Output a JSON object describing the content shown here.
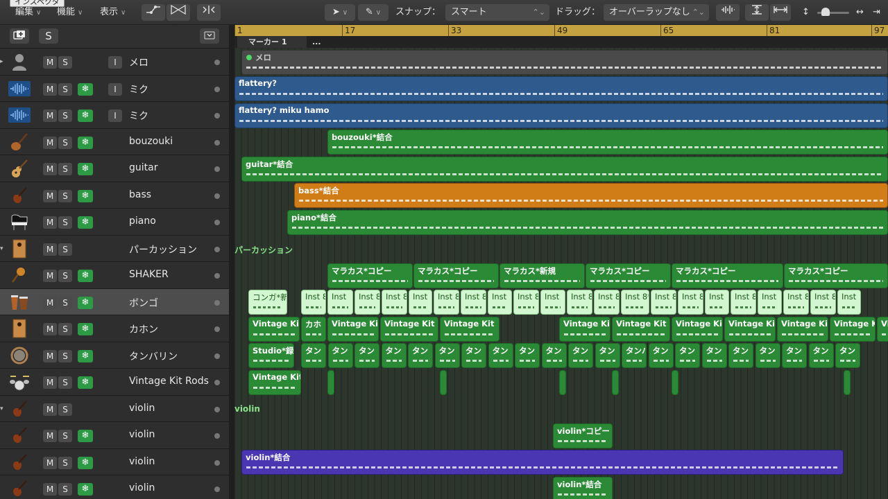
{
  "inspector_tip": "インスペクタ",
  "toolbar": {
    "menus": [
      {
        "label": "編集"
      },
      {
        "label": "機能"
      },
      {
        "label": "表示"
      }
    ],
    "snap_label": "スナップ：",
    "snap_value": "スマート",
    "drag_label": "ドラッグ：",
    "drag_value": "オーバーラップなし"
  },
  "track_header": {
    "add_icon": "add-track-icon",
    "s_button": "S",
    "collapse_icon": "collapse-icon"
  },
  "tracks": [
    {
      "name": "メロ",
      "icon": "person-icon",
      "i": "I",
      "freeze": false,
      "disclosure": "▸"
    },
    {
      "name": "ミク",
      "icon": "waveform-icon",
      "i": "I",
      "freeze": true
    },
    {
      "name": "ミク",
      "icon": "waveform-icon",
      "i": "I",
      "freeze": true
    },
    {
      "name": "bouzouki",
      "icon": "bouzouki-icon",
      "freeze": true
    },
    {
      "name": "guitar",
      "icon": "guitar-icon",
      "freeze": true
    },
    {
      "name": "bass",
      "icon": "violin-icon",
      "freeze": true
    },
    {
      "name": "piano",
      "icon": "piano-icon",
      "freeze": true
    },
    {
      "name": "パーカッション",
      "icon": "cajon-icon",
      "freeze": false,
      "disclosure": "▾"
    },
    {
      "name": "SHAKER",
      "icon": "maracas-icon",
      "freeze": true
    },
    {
      "name": "ボンゴ",
      "icon": "bongo-icon",
      "freeze": true,
      "selected": true
    },
    {
      "name": "カホン",
      "icon": "cajon-icon",
      "freeze": true
    },
    {
      "name": "タンバリン",
      "icon": "tambourine-icon",
      "freeze": true
    },
    {
      "name": "Vintage Kit Rods",
      "icon": "drumkit-icon",
      "freeze": true
    },
    {
      "name": "violin",
      "icon": "violin-icon",
      "freeze": false,
      "disclosure": "▾"
    },
    {
      "name": "violin",
      "icon": "violin-icon",
      "freeze": true
    },
    {
      "name": "violin",
      "icon": "violin-icon",
      "freeze": true
    },
    {
      "name": "violin",
      "icon": "violin-icon",
      "freeze": true
    }
  ],
  "button_labels": {
    "m": "M",
    "s": "S",
    "i": "I",
    "freeze": "❄"
  },
  "ruler": [
    "1",
    "17",
    "33",
    "49",
    "65",
    "81",
    "97"
  ],
  "markers": [
    {
      "label": "マーカー 1"
    },
    {
      "label": "..."
    }
  ],
  "regions": {
    "mero": "メロ",
    "flattery1": "flattery?",
    "flattery2": "flattery? miku hamo",
    "bouzouki": "bouzouki*結合",
    "guitar": "guitar*結合",
    "bass": "bass*結合",
    "piano": "piano*結合",
    "perc_folder": "パーカッション",
    "shaker": [
      "マラカス*コピー",
      "マラカス*コピー",
      "マラカス*新規",
      "マラカス*コピー",
      "マラカス*コピー",
      "マラカス*コピー"
    ],
    "bongo_first": "コンガ*新",
    "bongo": [
      "Inst 8",
      "Inst",
      "Inst 8",
      "Inst 8",
      "Inst",
      "Inst 8",
      "Inst 8",
      "Inst",
      "Inst 8",
      "Inst",
      "Inst 8",
      "Inst 8",
      "Inst 8*",
      "Inst 8",
      "Inst 8",
      "Inst",
      "Inst 8",
      "Inst",
      "Inst 8",
      "Inst 8",
      "Inst"
    ],
    "cajon": [
      "Vintage Kit",
      "カホ",
      "Vintage Kit",
      "Vintage Kit",
      "Vintage Kit",
      "Vintage Kit",
      "Vintage Kit R",
      "Vintage Kit",
      "Vintage Kit",
      "Vintage Kit",
      "Vintage Kit",
      "Vin"
    ],
    "tamb_first": "Studio*録",
    "tamb": [
      "タン",
      "タン",
      "タン",
      "タン",
      "タン",
      "タン",
      "タン",
      "タン",
      "タン",
      "タン",
      "タン",
      "タン",
      "タンバ",
      "タン",
      "タン",
      "タン",
      "タン",
      "タン",
      "タン",
      "タン",
      "タン"
    ],
    "rods": "Vintage Kit",
    "violin_folder": "violin",
    "violin_copy": "violin*コピー",
    "violin_join": "violin*結合",
    "violin_join2": "violin*結合"
  }
}
